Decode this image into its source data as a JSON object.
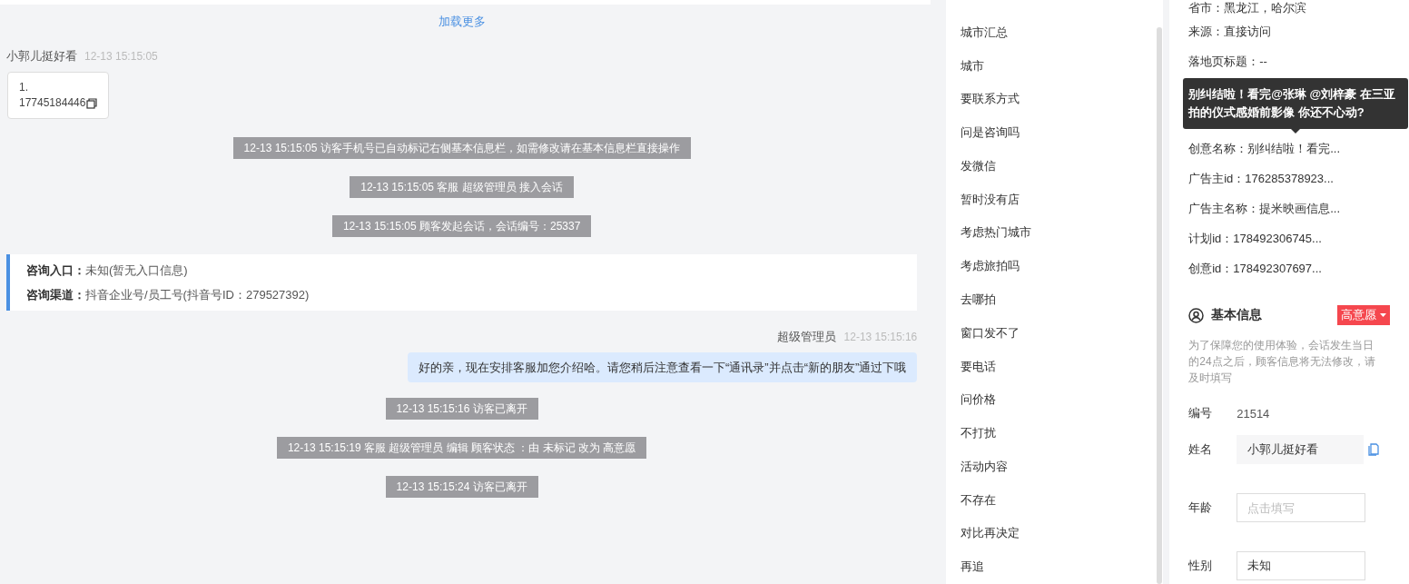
{
  "chat": {
    "load_more": "加载更多",
    "messages": [
      {
        "kind": "visitor",
        "sender": "小郭儿挺好看",
        "time": "12-13 15:15:05",
        "lines": [
          "1.",
          "17745184446"
        ]
      },
      {
        "kind": "system",
        "text": "12-13 15:15:05 访客手机号已自动标记右侧基本信息栏，如需修改请在基本信息栏直接操作"
      },
      {
        "kind": "system",
        "text": "12-13 15:15:05 客服 超级管理员 接入会话"
      },
      {
        "kind": "system",
        "text": "12-13 15:15:05 顾客发起会话，会话编号：25337"
      },
      {
        "kind": "entry",
        "rows": [
          {
            "label": "咨询入口：",
            "value": "未知(暂无入口信息)"
          },
          {
            "label": "咨询渠道：",
            "value": "抖音企业号/员工号(抖音号ID：279527392)"
          }
        ]
      },
      {
        "kind": "agent",
        "sender": "超级管理员",
        "time": "12-13 15:15:16",
        "text": "好的亲，现在安排客服加您介绍哈。请您稍后注意查看一下“通讯录”并点击“新的朋友”通过下哦"
      },
      {
        "kind": "system",
        "text": "12-13 15:15:16 访客已离开"
      },
      {
        "kind": "system",
        "text": "12-13 15:15:19 客服 超级管理员 编辑 顾客状态 ：由 未标记 改为 高意愿"
      },
      {
        "kind": "system",
        "text": "12-13 15:15:24 访客已离开"
      }
    ]
  },
  "quick_replies": [
    "城市汇总",
    "城市",
    "要联系方式",
    "问是咨询吗",
    "发微信",
    "暂时没有店",
    "考虑热门城市",
    "考虑旅拍吗",
    "去哪拍",
    "窗口发不了",
    "要电话",
    "问价格",
    "不打扰",
    "活动内容",
    "不存在",
    "对比再决定",
    "再追"
  ],
  "info": {
    "source_fields": [
      {
        "kind": "field",
        "text": "省市：黑龙江，哈尔滨"
      },
      {
        "kind": "field",
        "text": "来源：直接访问"
      },
      {
        "kind": "field",
        "text": "落地页标题：--"
      },
      {
        "kind": "tooltip",
        "text": "别纠结啦！看完@张琳 @刘梓豪 在三亚拍的仪式感婚前影像 你还不心动?"
      },
      {
        "kind": "field",
        "text": "创意名称：别纠结啦！看完..."
      },
      {
        "kind": "field",
        "text": "广告主id：176285378923..."
      },
      {
        "kind": "field",
        "text": "广告主名称：提米映画信息..."
      },
      {
        "kind": "field",
        "text": "计划id：178492306745..."
      },
      {
        "kind": "field",
        "text": "创意id：178492307697..."
      }
    ],
    "basic": {
      "title": "基本信息",
      "intent_tag": "高意愿",
      "notice": "为了保障您的使用体验，会话发生当日的24点之后，顾客信息将无法修改，请及时填写",
      "fields": [
        {
          "kind": "static",
          "label": "编号",
          "value": "21514"
        },
        {
          "kind": "readonly",
          "label": "姓名",
          "value": "小郭儿挺好看"
        },
        {
          "kind": "input",
          "label": "年龄",
          "placeholder": "点击填写"
        },
        {
          "kind": "input",
          "label": "性别",
          "value": "未知"
        }
      ]
    }
  }
}
